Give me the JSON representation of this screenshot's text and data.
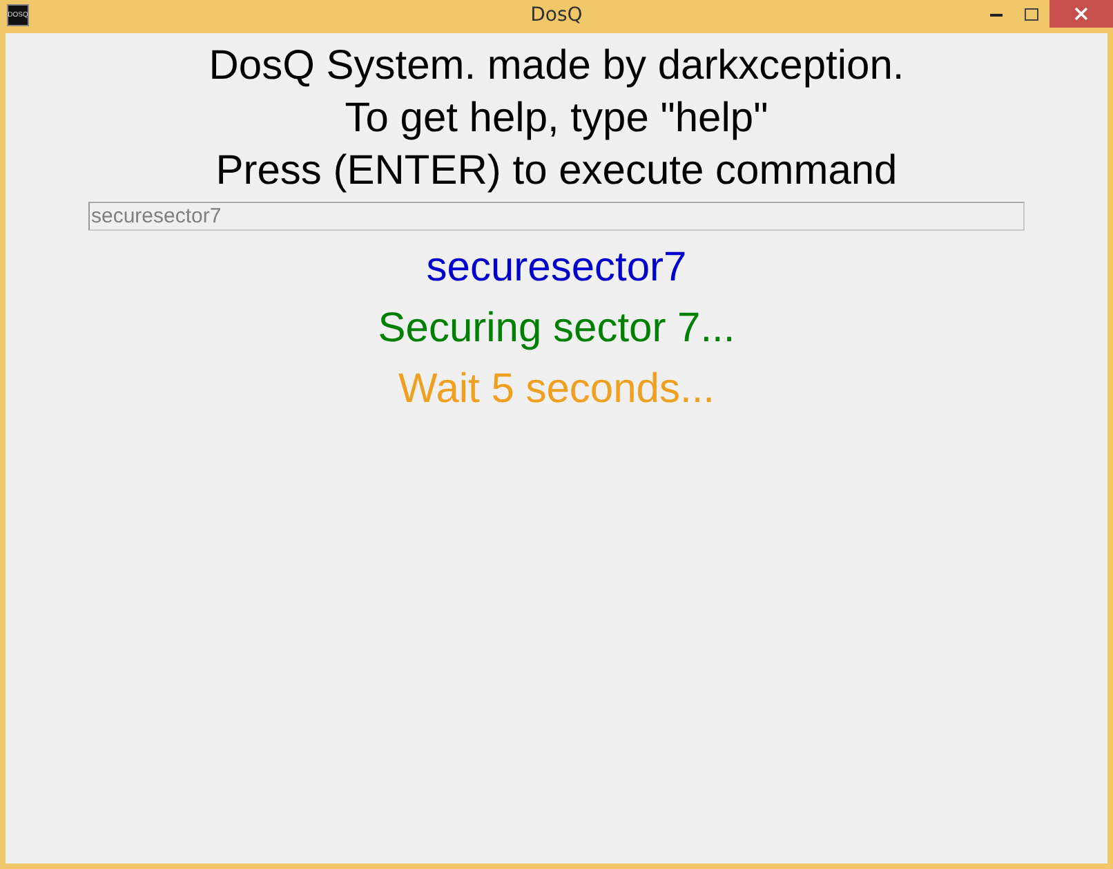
{
  "window": {
    "title": "DosQ",
    "app_icon_text": "DOSQ"
  },
  "header": [
    "DosQ System. made by darkxception.",
    "To get help, type \"help\"",
    "Press (ENTER) to execute command"
  ],
  "command_field": {
    "value": "securesector7"
  },
  "output": [
    {
      "text": "securesector7",
      "color": "#0000cc"
    },
    {
      "text": "Securing sector 7...",
      "color": "#008000"
    },
    {
      "text": "Wait 5 seconds...",
      "color": "#f0a020"
    }
  ]
}
